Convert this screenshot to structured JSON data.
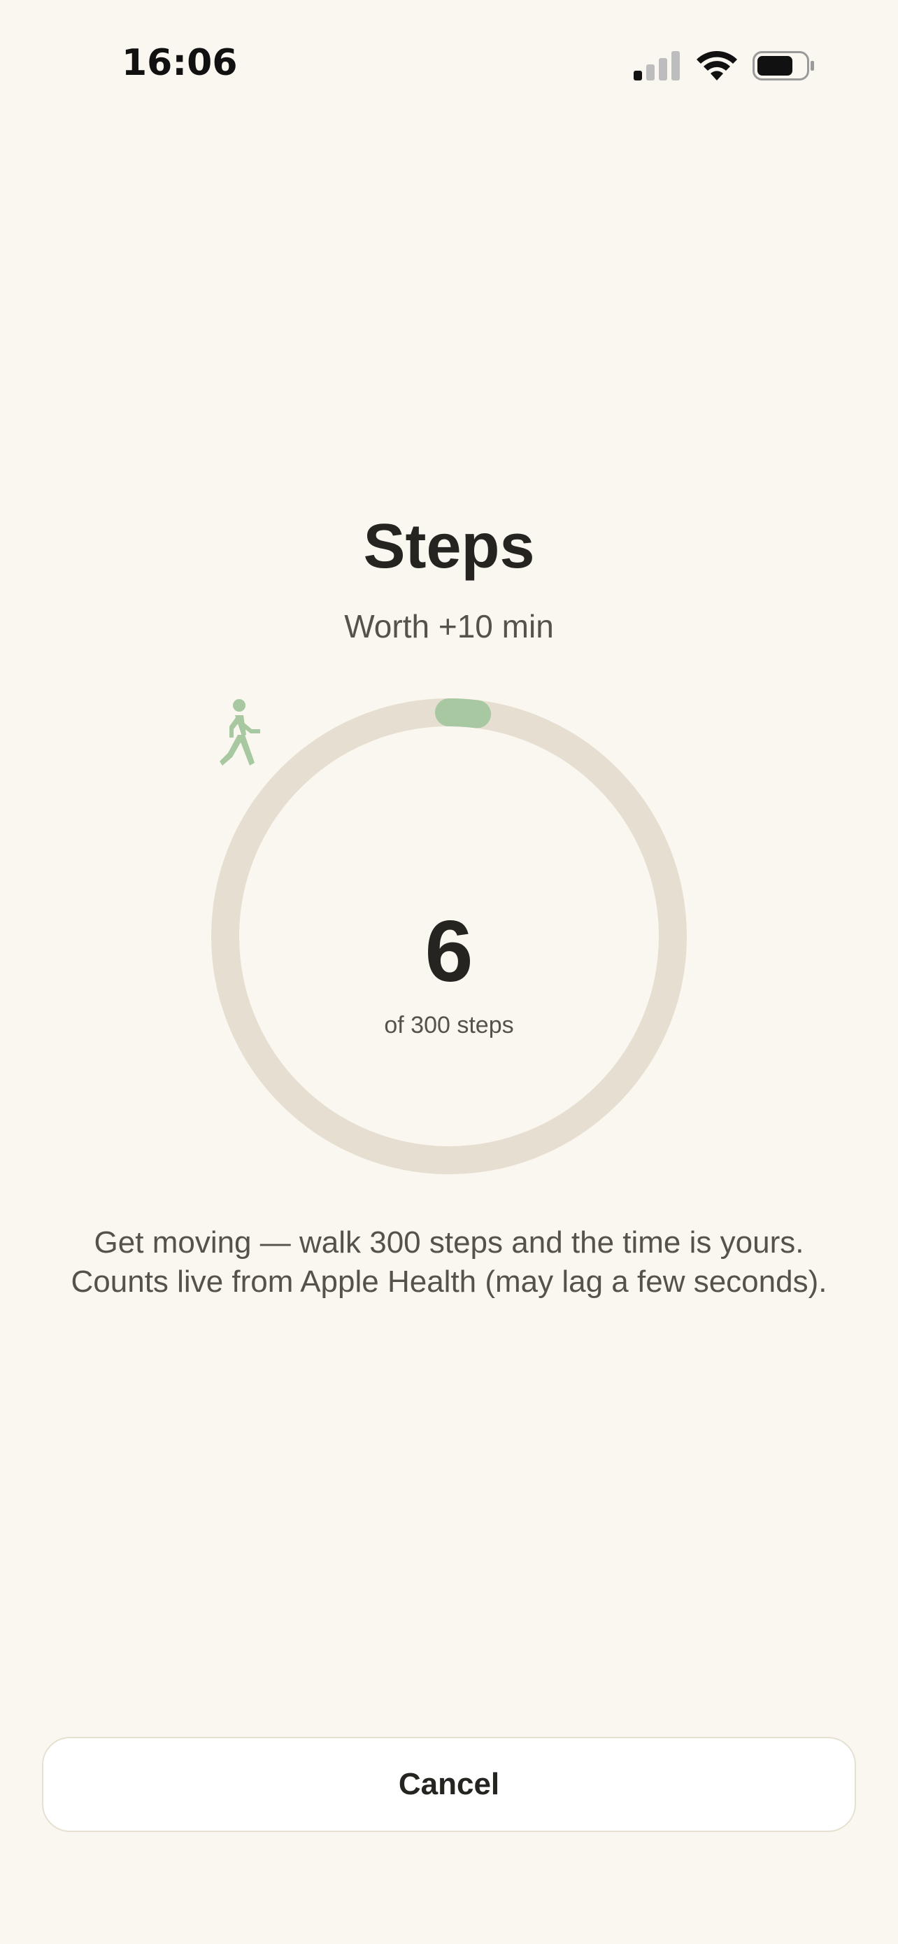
{
  "status_bar": {
    "time": "16:06",
    "icons": [
      "cellular-signal-icon",
      "wifi-icon",
      "battery-icon"
    ]
  },
  "header": {
    "title": "Steps",
    "subtitle": "Worth +10 min"
  },
  "progress": {
    "current": "6",
    "goal_label": "of 300 steps",
    "current_value": 6,
    "goal_value": 300,
    "icon": "walking-person-icon",
    "track_color": "#E6DED0",
    "fill_color": "#A7C8A0"
  },
  "description": "Get moving — walk 300 steps and the time is yours. Counts live from Apple Health (may lag a few seconds).",
  "actions": {
    "cancel_label": "Cancel"
  },
  "colors": {
    "background": "#FAF7F0",
    "text_primary": "#262420",
    "text_secondary": "#55524B",
    "accent": "#A7C8A0"
  }
}
